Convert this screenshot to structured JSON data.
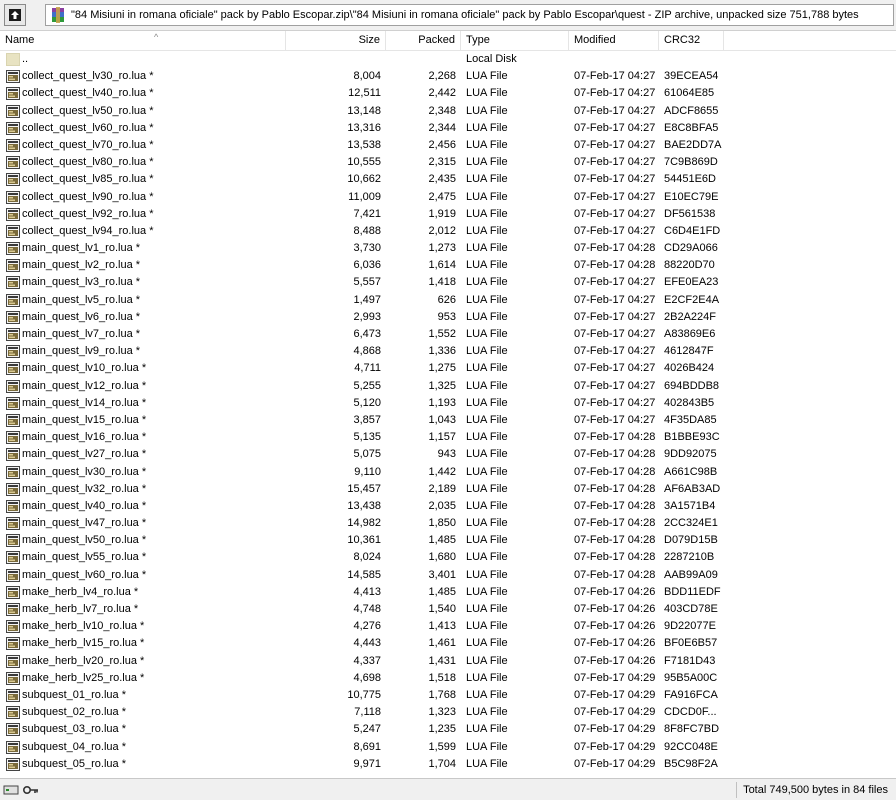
{
  "path": "\"84 Misiuni in romana oficiale\" pack by Pablo Escopar.zip\\\"84 Misiuni in romana oficiale\" pack by Pablo Escopar\\quest - ZIP archive, unpacked size 751,788 bytes",
  "columns": {
    "name": "Name",
    "size": "Size",
    "packed": "Packed",
    "type": "Type",
    "modified": "Modified",
    "crc": "CRC32"
  },
  "parent_row": {
    "name": "..",
    "type": "Local Disk"
  },
  "files": [
    {
      "name": "collect_quest_lv30_ro.lua *",
      "size": "8,004",
      "packed": "2,268",
      "type": "LUA File",
      "modified": "07-Feb-17 04:27",
      "crc": "39ECEA54"
    },
    {
      "name": "collect_quest_lv40_ro.lua *",
      "size": "12,511",
      "packed": "2,442",
      "type": "LUA File",
      "modified": "07-Feb-17 04:27",
      "crc": "61064E85"
    },
    {
      "name": "collect_quest_lv50_ro.lua *",
      "size": "13,148",
      "packed": "2,348",
      "type": "LUA File",
      "modified": "07-Feb-17 04:27",
      "crc": "ADCF8655"
    },
    {
      "name": "collect_quest_lv60_ro.lua *",
      "size": "13,316",
      "packed": "2,344",
      "type": "LUA File",
      "modified": "07-Feb-17 04:27",
      "crc": "E8C8BFA5"
    },
    {
      "name": "collect_quest_lv70_ro.lua *",
      "size": "13,538",
      "packed": "2,456",
      "type": "LUA File",
      "modified": "07-Feb-17 04:27",
      "crc": "BAE2DD7A"
    },
    {
      "name": "collect_quest_lv80_ro.lua *",
      "size": "10,555",
      "packed": "2,315",
      "type": "LUA File",
      "modified": "07-Feb-17 04:27",
      "crc": "7C9B869D"
    },
    {
      "name": "collect_quest_lv85_ro.lua *",
      "size": "10,662",
      "packed": "2,435",
      "type": "LUA File",
      "modified": "07-Feb-17 04:27",
      "crc": "54451E6D"
    },
    {
      "name": "collect_quest_lv90_ro.lua *",
      "size": "11,009",
      "packed": "2,475",
      "type": "LUA File",
      "modified": "07-Feb-17 04:27",
      "crc": "E10EC79E"
    },
    {
      "name": "collect_quest_lv92_ro.lua *",
      "size": "7,421",
      "packed": "1,919",
      "type": "LUA File",
      "modified": "07-Feb-17 04:27",
      "crc": "DF561538"
    },
    {
      "name": "collect_quest_lv94_ro.lua *",
      "size": "8,488",
      "packed": "2,012",
      "type": "LUA File",
      "modified": "07-Feb-17 04:27",
      "crc": "C6D4E1FD"
    },
    {
      "name": "main_quest_lv1_ro.lua *",
      "size": "3,730",
      "packed": "1,273",
      "type": "LUA File",
      "modified": "07-Feb-17 04:28",
      "crc": "CD29A066"
    },
    {
      "name": "main_quest_lv2_ro.lua *",
      "size": "6,036",
      "packed": "1,614",
      "type": "LUA File",
      "modified": "07-Feb-17 04:28",
      "crc": "88220D70"
    },
    {
      "name": "main_quest_lv3_ro.lua *",
      "size": "5,557",
      "packed": "1,418",
      "type": "LUA File",
      "modified": "07-Feb-17 04:27",
      "crc": "EFE0EA23"
    },
    {
      "name": "main_quest_lv5_ro.lua *",
      "size": "1,497",
      "packed": "626",
      "type": "LUA File",
      "modified": "07-Feb-17 04:27",
      "crc": "E2CF2E4A"
    },
    {
      "name": "main_quest_lv6_ro.lua *",
      "size": "2,993",
      "packed": "953",
      "type": "LUA File",
      "modified": "07-Feb-17 04:27",
      "crc": "2B2A224F"
    },
    {
      "name": "main_quest_lv7_ro.lua *",
      "size": "6,473",
      "packed": "1,552",
      "type": "LUA File",
      "modified": "07-Feb-17 04:27",
      "crc": "A83869E6"
    },
    {
      "name": "main_quest_lv9_ro.lua *",
      "size": "4,868",
      "packed": "1,336",
      "type": "LUA File",
      "modified": "07-Feb-17 04:27",
      "crc": "4612847F"
    },
    {
      "name": "main_quest_lv10_ro.lua *",
      "size": "4,711",
      "packed": "1,275",
      "type": "LUA File",
      "modified": "07-Feb-17 04:27",
      "crc": "4026B424"
    },
    {
      "name": "main_quest_lv12_ro.lua *",
      "size": "5,255",
      "packed": "1,325",
      "type": "LUA File",
      "modified": "07-Feb-17 04:27",
      "crc": "694BDDB8"
    },
    {
      "name": "main_quest_lv14_ro.lua *",
      "size": "5,120",
      "packed": "1,193",
      "type": "LUA File",
      "modified": "07-Feb-17 04:27",
      "crc": "402843B5"
    },
    {
      "name": "main_quest_lv15_ro.lua *",
      "size": "3,857",
      "packed": "1,043",
      "type": "LUA File",
      "modified": "07-Feb-17 04:27",
      "crc": "4F35DA85"
    },
    {
      "name": "main_quest_lv16_ro.lua *",
      "size": "5,135",
      "packed": "1,157",
      "type": "LUA File",
      "modified": "07-Feb-17 04:28",
      "crc": "B1BBE93C"
    },
    {
      "name": "main_quest_lv27_ro.lua *",
      "size": "5,075",
      "packed": "943",
      "type": "LUA File",
      "modified": "07-Feb-17 04:28",
      "crc": "9DD92075"
    },
    {
      "name": "main_quest_lv30_ro.lua *",
      "size": "9,110",
      "packed": "1,442",
      "type": "LUA File",
      "modified": "07-Feb-17 04:28",
      "crc": "A661C98B"
    },
    {
      "name": "main_quest_lv32_ro.lua *",
      "size": "15,457",
      "packed": "2,189",
      "type": "LUA File",
      "modified": "07-Feb-17 04:28",
      "crc": "AF6AB3AD"
    },
    {
      "name": "main_quest_lv40_ro.lua *",
      "size": "13,438",
      "packed": "2,035",
      "type": "LUA File",
      "modified": "07-Feb-17 04:28",
      "crc": "3A1571B4"
    },
    {
      "name": "main_quest_lv47_ro.lua *",
      "size": "14,982",
      "packed": "1,850",
      "type": "LUA File",
      "modified": "07-Feb-17 04:28",
      "crc": "2CC324E1"
    },
    {
      "name": "main_quest_lv50_ro.lua *",
      "size": "10,361",
      "packed": "1,485",
      "type": "LUA File",
      "modified": "07-Feb-17 04:28",
      "crc": "D079D15B"
    },
    {
      "name": "main_quest_lv55_ro.lua *",
      "size": "8,024",
      "packed": "1,680",
      "type": "LUA File",
      "modified": "07-Feb-17 04:28",
      "crc": "2287210B"
    },
    {
      "name": "main_quest_lv60_ro.lua *",
      "size": "14,585",
      "packed": "3,401",
      "type": "LUA File",
      "modified": "07-Feb-17 04:28",
      "crc": "AAB99A09"
    },
    {
      "name": "make_herb_lv4_ro.lua *",
      "size": "4,413",
      "packed": "1,485",
      "type": "LUA File",
      "modified": "07-Feb-17 04:26",
      "crc": "BDD11EDF"
    },
    {
      "name": "make_herb_lv7_ro.lua *",
      "size": "4,748",
      "packed": "1,540",
      "type": "LUA File",
      "modified": "07-Feb-17 04:26",
      "crc": "403CD78E"
    },
    {
      "name": "make_herb_lv10_ro.lua *",
      "size": "4,276",
      "packed": "1,413",
      "type": "LUA File",
      "modified": "07-Feb-17 04:26",
      "crc": "9D22077E"
    },
    {
      "name": "make_herb_lv15_ro.lua *",
      "size": "4,443",
      "packed": "1,461",
      "type": "LUA File",
      "modified": "07-Feb-17 04:26",
      "crc": "BF0E6B57"
    },
    {
      "name": "make_herb_lv20_ro.lua *",
      "size": "4,337",
      "packed": "1,431",
      "type": "LUA File",
      "modified": "07-Feb-17 04:26",
      "crc": "F7181D43"
    },
    {
      "name": "make_herb_lv25_ro.lua *",
      "size": "4,698",
      "packed": "1,518",
      "type": "LUA File",
      "modified": "07-Feb-17 04:29",
      "crc": "95B5A00C"
    },
    {
      "name": "subquest_01_ro.lua *",
      "size": "10,775",
      "packed": "1,768",
      "type": "LUA File",
      "modified": "07-Feb-17 04:29",
      "crc": "FA916FCA"
    },
    {
      "name": "subquest_02_ro.lua *",
      "size": "7,118",
      "packed": "1,323",
      "type": "LUA File",
      "modified": "07-Feb-17 04:29",
      "crc": "CDCD0F..."
    },
    {
      "name": "subquest_03_ro.lua *",
      "size": "5,247",
      "packed": "1,235",
      "type": "LUA File",
      "modified": "07-Feb-17 04:29",
      "crc": "8F8FC7BD"
    },
    {
      "name": "subquest_04_ro.lua *",
      "size": "8,691",
      "packed": "1,599",
      "type": "LUA File",
      "modified": "07-Feb-17 04:29",
      "crc": "92CC048E"
    },
    {
      "name": "subquest_05_ro.lua *",
      "size": "9,971",
      "packed": "1,704",
      "type": "LUA File",
      "modified": "07-Feb-17 04:29",
      "crc": "B5C98F2A"
    }
  ],
  "status": {
    "total": "Total 749,500 bytes in 84 files"
  },
  "icons": {
    "up": "up-arrow-icon",
    "archive": "winrar-archive-icon",
    "file": "lua-file-icon",
    "folder": "folder-icon",
    "drive": "drive-icon",
    "key": "key-icon"
  }
}
